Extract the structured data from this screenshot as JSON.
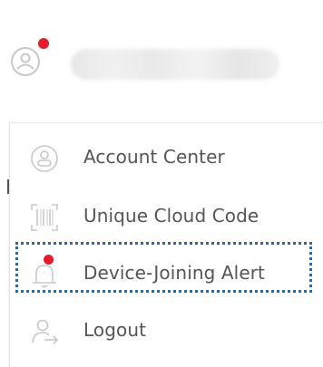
{
  "menu": {
    "items": [
      {
        "label": "Account Center",
        "icon": "account-icon"
      },
      {
        "label": "Unique Cloud Code",
        "icon": "qr-code-icon"
      },
      {
        "label": "Device-Joining Alert",
        "icon": "bell-icon",
        "has_notification": true
      },
      {
        "label": "Logout",
        "icon": "logout-icon"
      }
    ]
  },
  "colors": {
    "notification_dot": "#e21d2b",
    "focus_outline": "#1f6bb4",
    "label_text": "#555555",
    "icon_gray": "#c8c8c8"
  }
}
